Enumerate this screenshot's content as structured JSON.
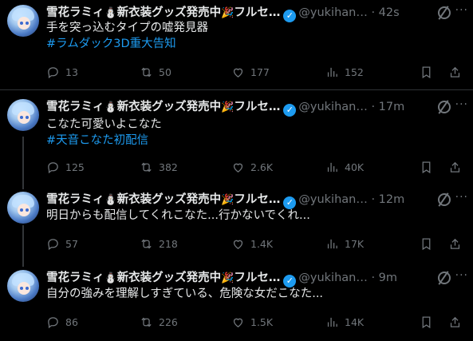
{
  "tweets": [
    {
      "name": "雪花ラミィ",
      "emoji1": "⛄",
      "name_mid": "新衣装グッズ発売中",
      "emoji2": "🎉",
      "name_end": "フルセ…",
      "handle": "@yukihan…",
      "dot": "·",
      "time": "42s",
      "text": "手を突っ込むタイプの嘘発見器",
      "hashtag": "#ラムダック3D重大告知",
      "replies": "13",
      "reposts": "50",
      "likes": "177",
      "views": "152"
    },
    {
      "name": "雪花ラミィ",
      "emoji1": "⛄",
      "name_mid": "新衣装グッズ発売中",
      "emoji2": "🎉",
      "name_end": "フルセ…",
      "handle": "@yukihan…",
      "dot": "·",
      "time": "17m",
      "text": "こなた可愛いよこなた",
      "hashtag": "#天音こなた初配信",
      "replies": "125",
      "reposts": "382",
      "likes": "2.6K",
      "views": "40K"
    },
    {
      "name": "雪花ラミィ",
      "emoji1": "⛄",
      "name_mid": "新衣装グッズ発売中",
      "emoji2": "🎉",
      "name_end": "フルセ…",
      "handle": "@yukihan…",
      "dot": "·",
      "time": "12m",
      "text": "明日からも配信してくれこなた...行かないでくれ...",
      "replies": "57",
      "reposts": "218",
      "likes": "1.4K",
      "views": "17K"
    },
    {
      "name": "雪花ラミィ",
      "emoji1": "⛄",
      "name_mid": "新衣装グッズ発売中",
      "emoji2": "🎉",
      "name_end": "フルセ…",
      "handle": "@yukihan…",
      "dot": "·",
      "time": "9m",
      "text": "自分の強みを理解しすぎている、危険な女だこなた...",
      "replies": "86",
      "reposts": "226",
      "likes": "1.5K",
      "views": "14K"
    }
  ],
  "verified_glyph": "✓",
  "more_glyph": "···",
  "colors": {
    "background": "#000000",
    "text": "#e7e9ea",
    "muted": "#71767b",
    "accent": "#1d9bf0",
    "divider": "#2f3336"
  }
}
